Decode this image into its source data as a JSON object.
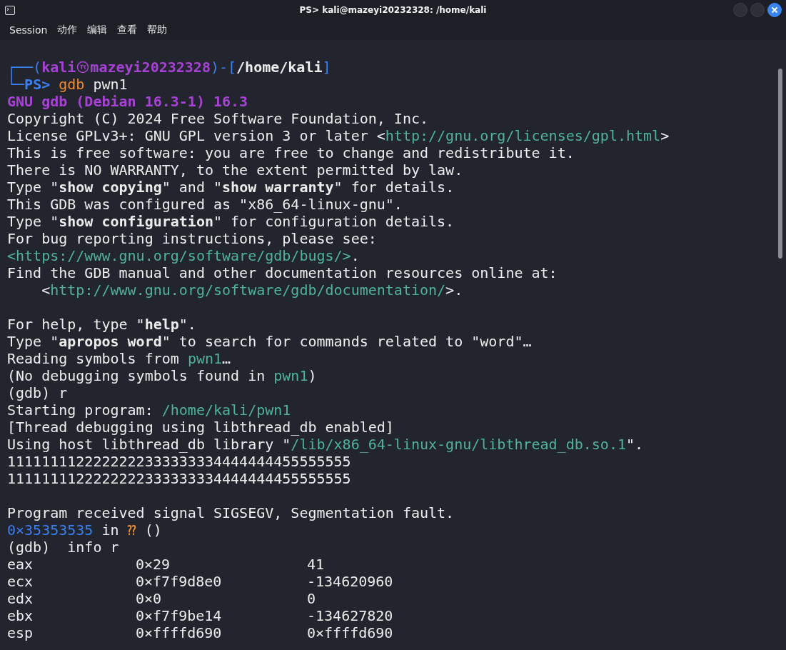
{
  "window": {
    "title": "PS> kali@mazeyi20232328: /home/kali"
  },
  "menu": [
    "Session",
    "动作",
    "编辑",
    "查看",
    "帮助"
  ],
  "lines": [
    {
      "kind": "text",
      "segments": [
        {
          "kind": "frame",
          "text": "┌──("
        },
        {
          "kind": "user",
          "text": "kali"
        },
        {
          "kind": "separator"
        },
        {
          "kind": "user",
          "text": "mazeyi20232328"
        },
        {
          "kind": "frame",
          "text": ")-["
        },
        {
          "kind": "keyword",
          "text": "/home/kali"
        },
        {
          "kind": "frame",
          "text": "]"
        }
      ]
    },
    {
      "kind": "text",
      "segments": [
        {
          "kind": "frame",
          "text": "└─"
        },
        {
          "kind": "prompt",
          "text": "PS> "
        },
        {
          "kind": "command",
          "text": "gdb"
        },
        {
          "kind": "text",
          "text": " pwn1"
        }
      ]
    },
    {
      "kind": "text",
      "segments": [
        {
          "kind": "banner",
          "text": "GNU gdb (Debian 16.3-1) 16.3"
        }
      ]
    },
    {
      "kind": "text",
      "segments": [
        {
          "kind": "text",
          "text": "Copyright (C) 2024 Free Software Foundation, Inc."
        }
      ]
    },
    {
      "kind": "text",
      "segments": [
        {
          "kind": "text",
          "text": "License GPLv3+: GNU GPL version 3 or later <"
        },
        {
          "kind": "link",
          "text": "http://gnu.org/licenses/gpl.html"
        },
        {
          "kind": "text",
          "text": ">"
        }
      ]
    },
    {
      "kind": "text",
      "segments": [
        {
          "kind": "text",
          "text": "This is free software: you are free to change and redistribute it."
        }
      ]
    },
    {
      "kind": "text",
      "segments": [
        {
          "kind": "text",
          "text": "There is NO WARRANTY, to the extent permitted by law."
        }
      ]
    },
    {
      "kind": "text",
      "segments": [
        {
          "kind": "text",
          "text": "Type \""
        },
        {
          "kind": "keyword",
          "text": "show copying"
        },
        {
          "kind": "text",
          "text": "\" and \""
        },
        {
          "kind": "keyword",
          "text": "show warranty"
        },
        {
          "kind": "text",
          "text": "\" for details."
        }
      ]
    },
    {
      "kind": "text",
      "segments": [
        {
          "kind": "text",
          "text": "This GDB was configured as \"x86_64-linux-gnu\"."
        }
      ]
    },
    {
      "kind": "text",
      "segments": [
        {
          "kind": "text",
          "text": "Type \""
        },
        {
          "kind": "keyword",
          "text": "show configuration"
        },
        {
          "kind": "text",
          "text": "\" for configuration details."
        }
      ]
    },
    {
      "kind": "text",
      "segments": [
        {
          "kind": "text",
          "text": "For bug reporting instructions, please see:"
        }
      ]
    },
    {
      "kind": "text",
      "segments": [
        {
          "kind": "link",
          "text": "<https://www.gnu.org/software/gdb/bugs/>"
        },
        {
          "kind": "text",
          "text": "."
        }
      ]
    },
    {
      "kind": "text",
      "segments": [
        {
          "kind": "text",
          "text": "Find the GDB manual and other documentation resources online at:"
        }
      ]
    },
    {
      "kind": "text",
      "segments": [
        {
          "kind": "text",
          "text": "    <"
        },
        {
          "kind": "link",
          "text": "http://www.gnu.org/software/gdb/documentation/"
        },
        {
          "kind": "text",
          "text": ">."
        }
      ]
    },
    {
      "kind": "blank"
    },
    {
      "kind": "text",
      "segments": [
        {
          "kind": "text",
          "text": "For help, type \""
        },
        {
          "kind": "keyword",
          "text": "help"
        },
        {
          "kind": "text",
          "text": "\"."
        }
      ]
    },
    {
      "kind": "text",
      "segments": [
        {
          "kind": "text",
          "text": "Type \""
        },
        {
          "kind": "keyword",
          "text": "apropos word"
        },
        {
          "kind": "text",
          "text": "\" to search for commands related to \"word\"…"
        }
      ]
    },
    {
      "kind": "text",
      "segments": [
        {
          "kind": "text",
          "text": "Reading symbols from "
        },
        {
          "kind": "link",
          "text": "pwn1"
        },
        {
          "kind": "text",
          "text": "…"
        }
      ]
    },
    {
      "kind": "text",
      "segments": [
        {
          "kind": "text",
          "text": "(No debugging symbols found in "
        },
        {
          "kind": "link",
          "text": "pwn1"
        },
        {
          "kind": "text",
          "text": ")"
        }
      ]
    },
    {
      "kind": "text",
      "segments": [
        {
          "kind": "text",
          "text": "(gdb) r"
        }
      ]
    },
    {
      "kind": "text",
      "segments": [
        {
          "kind": "text",
          "text": "Starting program: "
        },
        {
          "kind": "link",
          "text": "/home/kali/pwn1"
        }
      ]
    },
    {
      "kind": "text",
      "segments": [
        {
          "kind": "text",
          "text": "[Thread debugging using libthread_db enabled]"
        }
      ]
    },
    {
      "kind": "text",
      "segments": [
        {
          "kind": "text",
          "text": "Using host libthread_db library \""
        },
        {
          "kind": "link",
          "text": "/lib/x86_64-linux-gnu/libthread_db.so.1"
        },
        {
          "kind": "text",
          "text": "\"."
        }
      ]
    },
    {
      "kind": "text",
      "segments": [
        {
          "kind": "text",
          "text": "1111111122222222333333334444444455555555"
        }
      ]
    },
    {
      "kind": "text",
      "segments": [
        {
          "kind": "text",
          "text": "1111111122222222333333334444444455555555"
        }
      ]
    },
    {
      "kind": "blank"
    },
    {
      "kind": "text",
      "segments": [
        {
          "kind": "text",
          "text": "Program received signal SIGSEGV, Segmentation fault."
        }
      ]
    },
    {
      "kind": "text",
      "segments": [
        {
          "kind": "address",
          "text": "0×35353535"
        },
        {
          "kind": "text",
          "text": " in "
        },
        {
          "kind": "unknown",
          "text": "⁇"
        },
        {
          "kind": "text",
          "text": " ()"
        }
      ]
    },
    {
      "kind": "text",
      "segments": [
        {
          "kind": "text",
          "text": "(gdb)  info r"
        }
      ]
    }
  ],
  "registers": [
    {
      "name": "eax",
      "hex": "0×29",
      "value": "41"
    },
    {
      "name": "ecx",
      "hex": "0×f7f9d8e0",
      "value": "-134620960"
    },
    {
      "name": "edx",
      "hex": "0×0",
      "value": "0"
    },
    {
      "name": "ebx",
      "hex": "0×f7f9be14",
      "value": "-134627820"
    },
    {
      "name": "esp",
      "hex": "0×ffffd690",
      "value": "0×ffffd690"
    }
  ]
}
